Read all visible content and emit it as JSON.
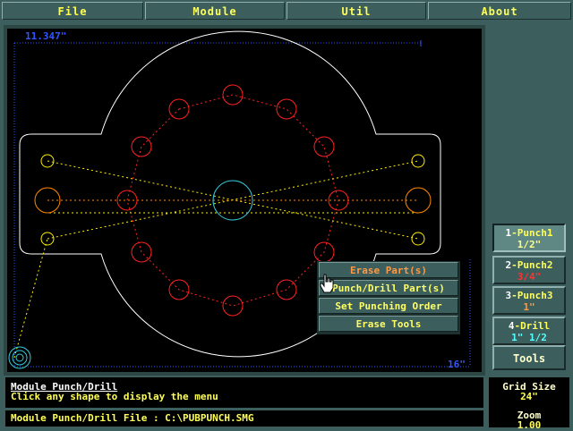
{
  "menu": [
    "File",
    "Module",
    "Util",
    "About"
  ],
  "canvas": {
    "coord_top_left": "11.347\"",
    "coord_bottom_right": "16\""
  },
  "context_menu": {
    "items": [
      "Erase Part(s)",
      "Punch/Drill Part(s)",
      "Set Punching Order",
      "Erase Tools"
    ]
  },
  "tools": [
    {
      "num": "1",
      "name": "Punch1",
      "size": "1/2\""
    },
    {
      "num": "2",
      "name": "Punch2",
      "size": "3/4\""
    },
    {
      "num": "3",
      "name": "Punch3",
      "size": "1\""
    },
    {
      "num": "4",
      "name": "Drill",
      "size": "1\" 1/2"
    }
  ],
  "tools_label": "Tools",
  "status": {
    "title": "Module Punch/Drill",
    "message": "Click any shape to display the menu",
    "file": "Module Punch/Drill File : C:\\PUBPUNCH.SMG"
  },
  "grid": {
    "label": "Grid Size",
    "value": "24\""
  },
  "zoom": {
    "label": "Zoom",
    "value": "1.00"
  },
  "colors": {
    "accent": "#ffff55",
    "panel": "#3c5e5c",
    "red_holes": "#ff2222",
    "orange_holes": "#ff8800",
    "yellow_holes": "#ffee00",
    "cyan_center": "#33ccdd"
  }
}
